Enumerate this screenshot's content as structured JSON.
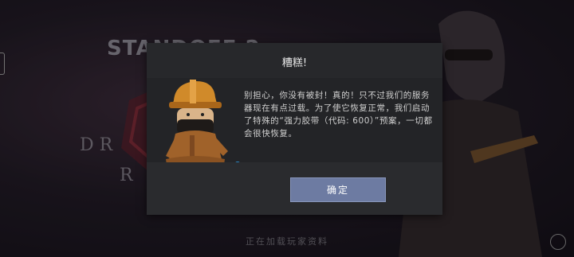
{
  "background": {
    "logo_text": "STANDOFF 2",
    "letters_row1": "D R",
    "letters_row2": "R",
    "loading_status": "正在加载玩家资料"
  },
  "dialog": {
    "title": "糟糕!",
    "message": "别担心，你没有被封！真的！只不过我们的服务器现在有点过载。为了使它恢复正常，我们启动了特殊的“强力胶带（代码: 600）”预案，一切都会很快恢复。",
    "confirm_label": "确定"
  },
  "colors": {
    "dialog_bg": "#2a2b2e",
    "dialog_body_bg": "#232427",
    "button_bg": "#6d7ba2",
    "text": "#cfcfcf"
  },
  "icons": {
    "mascot": "mechanic-mascot-icon",
    "home": "home-circle-icon",
    "handle": "edge-handle-icon"
  }
}
